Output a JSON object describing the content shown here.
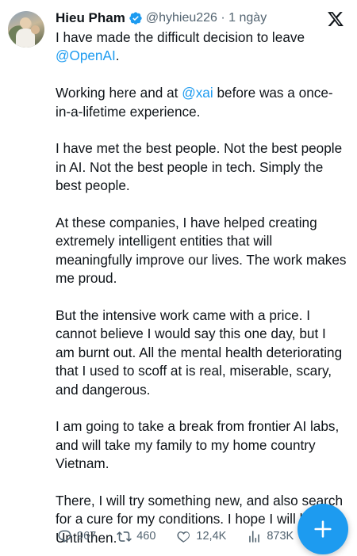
{
  "user": {
    "name": "Hieu Pham",
    "handle_time": "@hyhieu226 · 1 ngày"
  },
  "tweet": {
    "p1_text": "I have made the difficult decision to leave",
    "p1_mention": "@OpenAI",
    "p1_end": ".",
    "p2_a": "Working here and at ",
    "p2_mention": "@xai",
    "p2_b": " before was a once-",
    "p2_c": "in-a-lifetime experience.",
    "p3": "I have met the best people. Not the best people in AI. Not the best people in tech. Simply the best people.",
    "p4": "At these companies, I have helped creating extremely intelligent entities that will meaningfully improve our lives. The work makes me proud.",
    "p5": "But the intensive work came with a price. I cannot believe I would say this one day, but I am burnt out. All the mental health deteriorating that I used to scoff at is real, miserable, scary, and dangerous.",
    "p6": "I am going to take a break from frontier AI labs, and will take my family to my home country Vietnam.",
    "p7": "There, I will try something new, and also search for a cure for my conditions. I hope I will heal. Until then."
  },
  "actions": {
    "replies": "967",
    "reposts": "460",
    "likes": "12,4K",
    "views": "873K"
  },
  "colors": {
    "accent": "#1d9bf0",
    "text": "#0f1419",
    "muted": "#536471"
  },
  "icons": [
    "verified-badge-icon",
    "x-logo-icon",
    "reply-icon",
    "repost-icon",
    "like-icon",
    "views-icon",
    "compose-plus-icon"
  ]
}
